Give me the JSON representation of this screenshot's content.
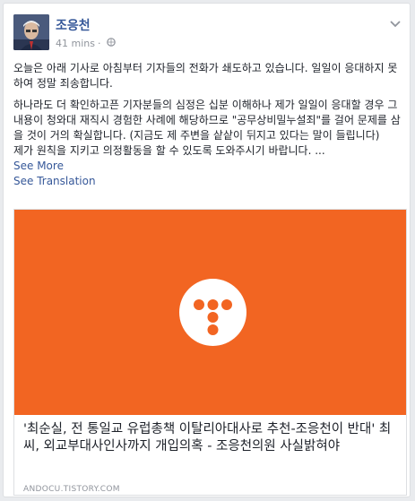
{
  "post": {
    "author": "조응천",
    "time": "41 mins",
    "privacy_icon": "globe-icon",
    "menu_icon": "chevron-down-icon",
    "paragraphs": [
      "오늘은 아래 기사로 아침부터 기자들의 전화가 쇄도하고 있습니다. 일일이 응대하지 못하여 정말 죄송합니다.",
      "하나라도 더 확인하고픈 기자분들의 심정은 십분 이해하나 제가 일일이 응대할 경우 그 내용이 청와대 재직시 경험한 사례에 해당하므로 \"공무상비밀누설죄\"를 걸어 문제를 삼을 것이 거의 확실합니다. (지금도 제 주변을 샅샅이 뒤지고 있다는 말이 들립니다)\n제가 원칙을 지키고 의정활동을 할 수 있도록 도와주시기 바랍니다. ..."
    ],
    "see_more": "See More",
    "see_translation": "See Translation"
  },
  "link_preview": {
    "title": "'최순실, 전 통일교 유럽총책 이탈리아대사로 추천-조응천이 반대' 최씨, 외교부대사인사까지 개입의혹 - 조응천의원 사실밝혀야",
    "domain": "ANDOCU.TISTORY.COM",
    "background_color": "#f26522",
    "logo_icon": "tistory-logo-icon"
  }
}
